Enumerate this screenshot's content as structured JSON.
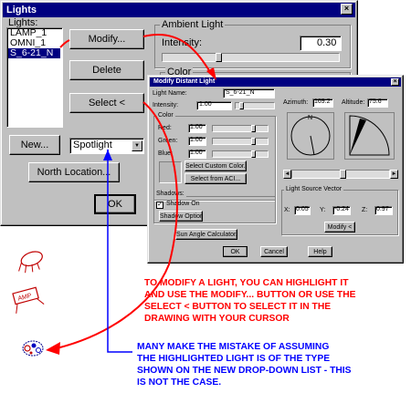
{
  "colors": {
    "titlebar": "#000080",
    "window_face": "#c0c0c0",
    "note_red": "#ff0000",
    "note_blue": "#0000ff"
  },
  "lights_dialog": {
    "title": "Lights",
    "close_glyph": "×",
    "lights_label": "Lights:",
    "lights_list": [
      "LAMP_1",
      "OMNI_1",
      "S_6-21_N"
    ],
    "selected_light": "S_6-21_N",
    "modify_button": "Modify...",
    "delete_button": "Delete",
    "select_button": "Select <",
    "new_button": "New...",
    "light_type_select": "Spotlight",
    "north_location_button": "North Location...",
    "ok_button": "OK",
    "ambient_light_group": "Ambient Light",
    "intensity_label": "Intensity:",
    "intensity_value": "0.30",
    "color_group": "Color"
  },
  "modify_dialog": {
    "title": "Modify Distant Light",
    "close_glyph": "×",
    "light_name_label": "Light Name:",
    "light_name_value": "S_6-21_N",
    "intensity_label": "Intensity:",
    "intensity_value": "1.00",
    "color_group": "Color",
    "red_label": "Red:",
    "red_value": "1.00",
    "green_label": "Green:",
    "green_value": "1.00",
    "blue_label": "Blue:",
    "blue_value": "1.00",
    "select_custom_color_button": "Select Custom Color...",
    "select_from_aci_button": "Select from ACI...",
    "azimuth_label": "Azimuth:",
    "azimuth_value": "169.2",
    "altitude_label": "Altitude:",
    "altitude_value": "75.6",
    "compass_north": "N",
    "shadows_group": "Shadows:",
    "shadow_on_checked": true,
    "shadow_on_label": "Shadow On",
    "shadow_options_button": "Shadow Options...",
    "light_source_vector_group": "Light Source Vector",
    "x_label": "X:",
    "x_value": "0.05",
    "y_label": "Y:",
    "y_value": "-0.24",
    "z_label": "Z:",
    "z_value": "0.97",
    "modify_button": "Modify <",
    "sun_angle_button": "Sun Angle Calculator...",
    "ok_button": "OK",
    "cancel_button": "Cancel",
    "help_button": "Help"
  },
  "notes": {
    "red_note_lines": [
      "TO MODIFY A LIGHT, YOU CAN HIGHLIGHT IT",
      "AND USE THE MODIFY... BUTTON OR USE THE",
      "SELECT < BUTTON TO SELECT IT IN THE",
      "DRAWING WITH YOUR CURSOR"
    ],
    "blue_note_lines": [
      "MANY MAKE THE MISTAKE OF ASSUMING",
      "THE HIGHLIGHTED LIGHT IS OF THE TYPE",
      "SHOWN ON THE NEW DROP-DOWN LIST - THIS",
      "IS NOT THE CASE."
    ],
    "icon_labels": [
      "LAMP_1",
      "S_6-21_N"
    ]
  }
}
